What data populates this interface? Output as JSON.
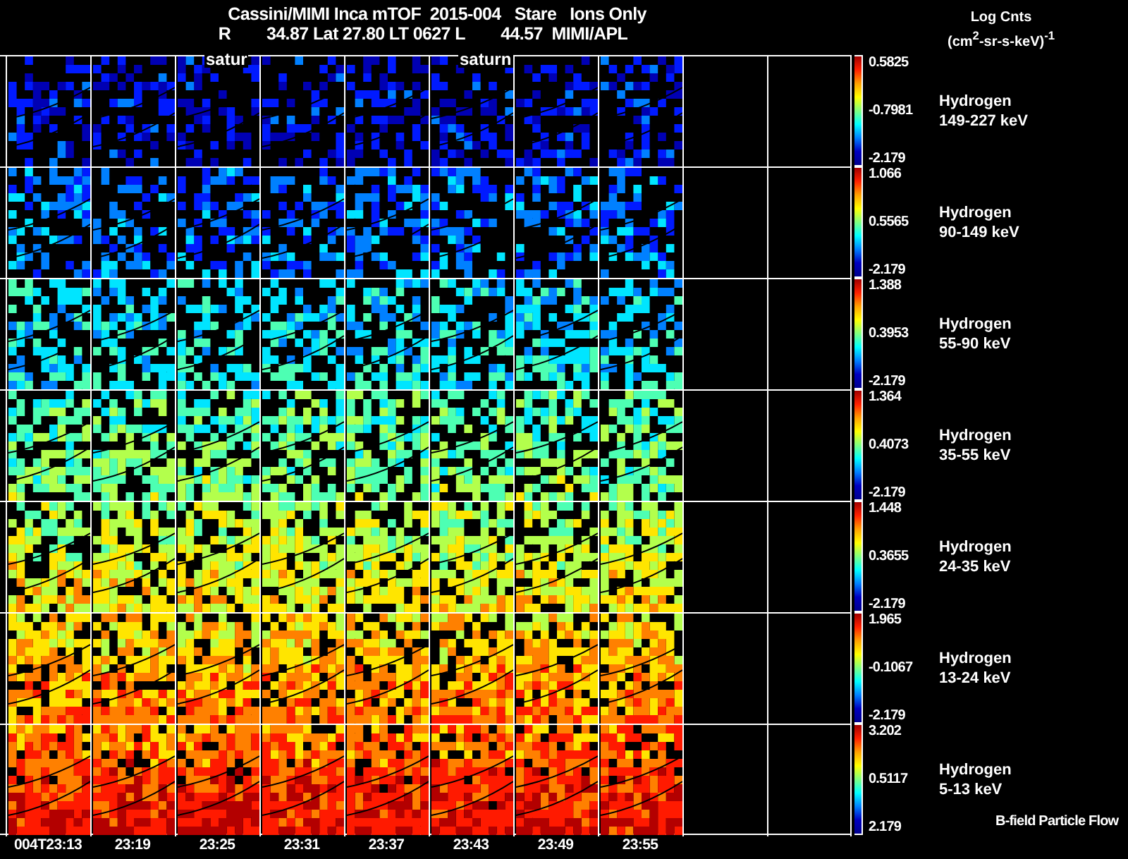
{
  "title": "Cassini/MIMI Inca mTOF  2015-004   Stare   Ions Only",
  "subtitle": "R        34.87 Lat 27.80 LT 0627 L        44.57  MIMI/APL",
  "scale_title": "Log Cnts",
  "scale_units": "(cm$^{2}$-sr-s-keV)$^{-1}$",
  "rows": [
    {
      "species": "Hydrogen",
      "energy": "149-227 keV",
      "max": "0.5825",
      "mid": "-0.7981",
      "min": "-2.179"
    },
    {
      "species": "Hydrogen",
      "energy": "90-149 keV",
      "max": "1.066",
      "mid": "0.5565",
      "min": "-2.179"
    },
    {
      "species": "Hydrogen",
      "energy": "55-90 keV",
      "max": "1.388",
      "mid": "0.3953",
      "min": "-2.179"
    },
    {
      "species": "Hydrogen",
      "energy": "35-55 keV",
      "max": "1.364",
      "mid": "0.4073",
      "min": "-2.179"
    },
    {
      "species": "Hydrogen",
      "energy": "24-35 keV",
      "max": "1.448",
      "mid": "0.3655",
      "min": "-2.179"
    },
    {
      "species": "Hydrogen",
      "energy": "13-24 keV",
      "max": "1.965",
      "mid": "-0.1067",
      "min": "-2.179"
    },
    {
      "species": "Hydrogen",
      "energy": "5-13 keV",
      "max": "3.202",
      "mid": "0.5117",
      "min": "2.179"
    }
  ],
  "columns": [
    {
      "time": "004T23:13"
    },
    {
      "time": "23:19"
    },
    {
      "time": "23:25",
      "overlay_label": "satur"
    },
    {
      "time": "23:31"
    },
    {
      "time": "23:37"
    },
    {
      "time": "23:43",
      "overlay_label": "saturn"
    },
    {
      "time": "23:49"
    },
    {
      "time": "23:55"
    }
  ],
  "footer_note": "B-field Particle Flow"
}
